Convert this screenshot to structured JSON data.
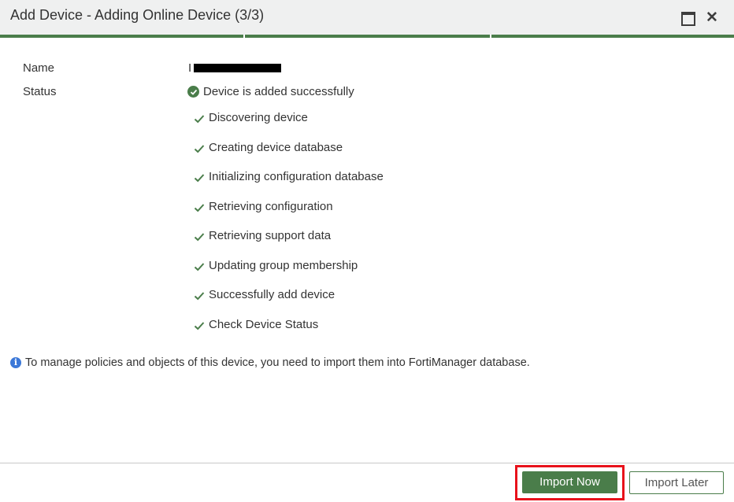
{
  "dialog": {
    "title": "Add Device - Adding Online Device (3/3)",
    "progress_step": "3/3"
  },
  "fields": {
    "name_label": "Name",
    "name_value_visible": "I",
    "status_label": "Status",
    "status_value": "Device is added successfully"
  },
  "steps": [
    "Discovering device",
    "Creating device database",
    "Initializing configuration database",
    "Retrieving configuration",
    "Retrieving support data",
    "Updating group membership",
    "Successfully add device",
    "Check Device Status"
  ],
  "info": {
    "icon": "i",
    "text": "To manage policies and objects of this device, you need to import them into FortiManager database."
  },
  "buttons": {
    "import_now": "Import Now",
    "import_later": "Import Later"
  },
  "colors": {
    "accent_green": "#4a7d4a",
    "info_blue": "#3b78d8",
    "highlight_red": "#e8121b"
  }
}
